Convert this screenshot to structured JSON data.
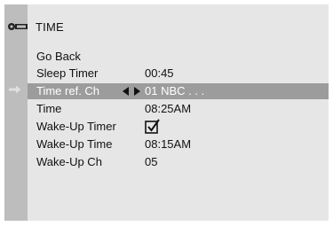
{
  "menu": {
    "title": "TIME"
  },
  "items": [
    {
      "label": "Go Back",
      "value": ""
    },
    {
      "label": "Sleep Timer",
      "value": "00:45"
    },
    {
      "label": "Time ref. Ch",
      "value": "01  NBC . . ."
    },
    {
      "label": "Time",
      "value": "08:25AM"
    },
    {
      "label": "Wake-Up Timer",
      "value": ""
    },
    {
      "label": "Wake-Up Time",
      "value": "08:15AM"
    },
    {
      "label": "Wake-Up Ch",
      "value": "05"
    }
  ],
  "selected_index": 2,
  "wake_up_timer_checked": true,
  "colors": {
    "panel": "#e6e6e6",
    "rail": "#bdbdbd",
    "highlight": "#9c9c9c"
  },
  "icons": {
    "header": "key-icon",
    "pointer": "arrow-right-icon",
    "adjust": "left-right-arrows-icon",
    "checkbox": "checkbox-checked-icon"
  }
}
